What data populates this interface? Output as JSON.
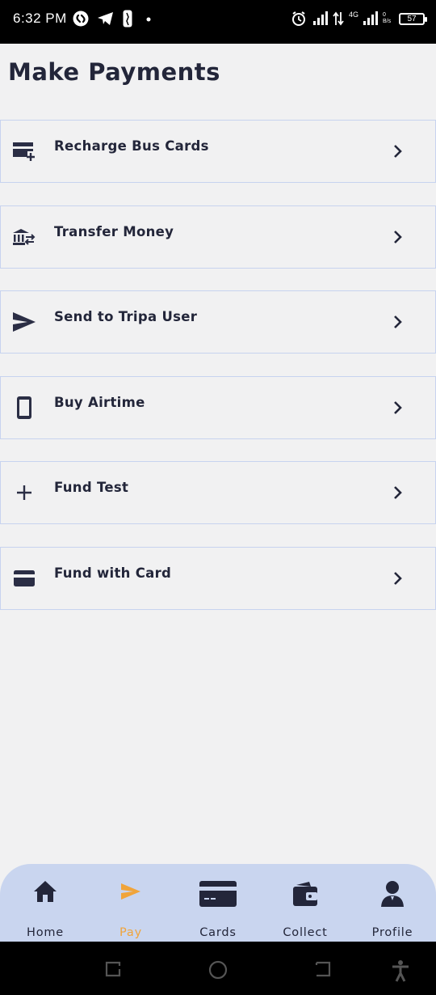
{
  "status_bar": {
    "time": "6:32 PM",
    "network": "4G",
    "speed": "0 B/s",
    "battery": "57"
  },
  "title": "Make Payments",
  "menu": [
    {
      "label": "Recharge Bus Cards",
      "icon": "card-add-icon"
    },
    {
      "label": "Transfer Money",
      "icon": "bank-transfer-icon"
    },
    {
      "label": "Send to Tripa User",
      "icon": "send-icon"
    },
    {
      "label": "Buy Airtime",
      "icon": "phone-icon"
    },
    {
      "label": "Fund Test",
      "icon": "plus-icon"
    },
    {
      "label": "Fund with Card",
      "icon": "credit-card-icon"
    }
  ],
  "bottom_nav": [
    {
      "label": "Home",
      "icon": "home-icon"
    },
    {
      "label": "Pay",
      "icon": "send-icon",
      "active": true
    },
    {
      "label": "Cards",
      "icon": "card-icon"
    },
    {
      "label": "Collect",
      "icon": "wallet-icon"
    },
    {
      "label": "Profile",
      "icon": "profile-icon"
    }
  ],
  "colors": {
    "accent": "#f0a43a",
    "text": "#23263a",
    "nav_background": "#c9d5ef",
    "item_border": "#c7d3ef",
    "background": "#f1f1f2"
  }
}
